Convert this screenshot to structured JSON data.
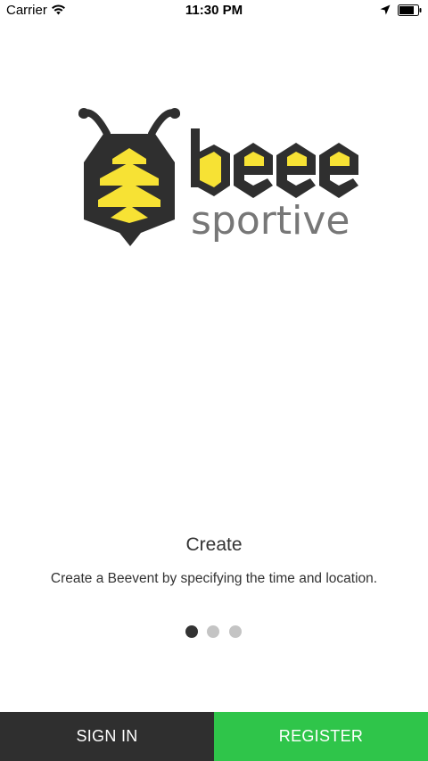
{
  "status_bar": {
    "carrier": "Carrier",
    "time": "11:30 PM"
  },
  "logo": {
    "wordmark_top": "bee",
    "wordmark_bottom": "sportive",
    "colors": {
      "dark": "#2f2f2f",
      "yellow": "#f7e234",
      "grey": "#777777"
    }
  },
  "onboarding": {
    "title": "Create",
    "description": "Create a Beevent by specifying the time and location.",
    "active_page": 1,
    "page_count": 3
  },
  "actions": {
    "sign_in_label": "SIGN IN",
    "register_label": "REGISTER"
  },
  "colors": {
    "sign_in_bg": "#2f2f2f",
    "register_bg": "#2fc54a",
    "dot_active": "#333333",
    "dot_inactive": "#c4c4c4"
  }
}
